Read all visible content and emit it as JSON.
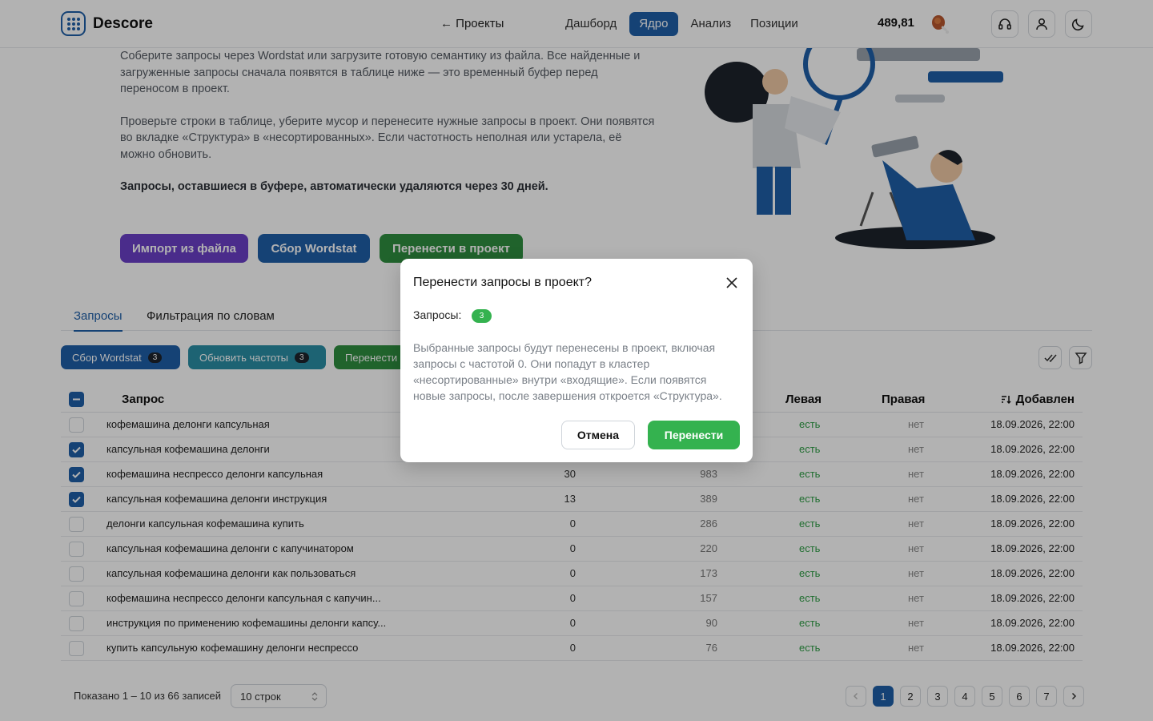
{
  "app": {
    "name": "Descore",
    "balance": "489,81"
  },
  "header": {
    "back_label": "← Проекты",
    "nav": [
      {
        "label": "Дашборд",
        "active": false
      },
      {
        "label": "Ядро",
        "active": true
      },
      {
        "label": "Анализ",
        "active": false
      },
      {
        "label": "Позиции",
        "active": false
      }
    ]
  },
  "intro": {
    "p1": "Соберите запросы через Wordstat или загрузите готовую семантику из файла. Все найденные и загруженные запросы сначала появятся в таблице ниже — это временный буфер перед переносом в проект.",
    "p2": "Проверьте строки в таблице, уберите мусор и перенесите нужные запросы в проект. Они появятся во вкладке «Структура» в «несортированных». Если частотность неполная или устарела, её можно обновить.",
    "p3": "Запросы, оставшиеся в буфере, автоматически удаляются через 30 дней."
  },
  "actions": {
    "import_label": "Импорт из файла",
    "wordstat_label": "Сбор Wordstat",
    "transfer_label": "Перенести в проект"
  },
  "tabs": [
    {
      "label": "Запросы",
      "active": true
    },
    {
      "label": "Фильтрация по словам",
      "active": false
    }
  ],
  "toolbar": {
    "wordstat_label": "Сбор Wordstat",
    "wordstat_count": "3",
    "update_label": "Обновить частоты",
    "update_count": "3",
    "transfer_label": "Перенести"
  },
  "table": {
    "headers": {
      "query": "Запрос",
      "left": "Левая",
      "right": "Правая",
      "added": "Добавлен"
    },
    "rows": [
      {
        "checked": false,
        "query": "кофемашина делонги капсульная",
        "freq": "",
        "freq2": "",
        "left": "есть",
        "right": "нет",
        "added": "18.09.2026, 22:00"
      },
      {
        "checked": true,
        "query": "капсульная кофемашина делонги",
        "freq": "",
        "freq2": "",
        "left": "есть",
        "right": "нет",
        "added": "18.09.2026, 22:00"
      },
      {
        "checked": true,
        "query": "кофемашина неспрессо делонги капсульная",
        "freq": "30",
        "freq2": "983",
        "left": "есть",
        "right": "нет",
        "added": "18.09.2026, 22:00"
      },
      {
        "checked": true,
        "query": "капсульная кофемашина делонги инструкция",
        "freq": "13",
        "freq2": "389",
        "left": "есть",
        "right": "нет",
        "added": "18.09.2026, 22:00"
      },
      {
        "checked": false,
        "query": "делонги капсульная кофемашина купить",
        "freq": "0",
        "freq2": "286",
        "left": "есть",
        "right": "нет",
        "added": "18.09.2026, 22:00"
      },
      {
        "checked": false,
        "query": "капсульная кофемашина делонги с капучинатором",
        "freq": "0",
        "freq2": "220",
        "left": "есть",
        "right": "нет",
        "added": "18.09.2026, 22:00"
      },
      {
        "checked": false,
        "query": "капсульная кофемашина делонги как пользоваться",
        "freq": "0",
        "freq2": "173",
        "left": "есть",
        "right": "нет",
        "added": "18.09.2026, 22:00"
      },
      {
        "checked": false,
        "query": "кофемашина неспрессо делонги капсульная с капучин...",
        "freq": "0",
        "freq2": "157",
        "left": "есть",
        "right": "нет",
        "added": "18.09.2026, 22:00"
      },
      {
        "checked": false,
        "query": "инструкция по применению кофемашины делонги капсу...",
        "freq": "0",
        "freq2": "90",
        "left": "есть",
        "right": "нет",
        "added": "18.09.2026, 22:00"
      },
      {
        "checked": false,
        "query": "купить капсульную кофемашину делонги неспрессо",
        "freq": "0",
        "freq2": "76",
        "left": "есть",
        "right": "нет",
        "added": "18.09.2026, 22:00"
      }
    ]
  },
  "footer": {
    "showing": "Показано 1 – 10 из 66 записей",
    "rows_per_page": "10 строк",
    "pages": [
      "1",
      "2",
      "3",
      "4",
      "5",
      "6",
      "7"
    ],
    "current_page": "1"
  },
  "modal": {
    "title": "Перенести запросы в проект?",
    "count_label": "Запросы:",
    "count": "3",
    "text": "Выбранные запросы будут перенесены в проект, включая запросы с частотой 0. Они попадут в кластер «несортированные» внутри «входящие». Если появятся новые запросы, после завершения откроется «Структура».",
    "cancel_label": "Отмена",
    "confirm_label": "Перенести"
  },
  "colors": {
    "primary": "#1f5fa8",
    "purple": "#6a3fc8",
    "green": "#2e9e45",
    "teal": "#2a8fa5",
    "confirm": "#34b24f"
  }
}
